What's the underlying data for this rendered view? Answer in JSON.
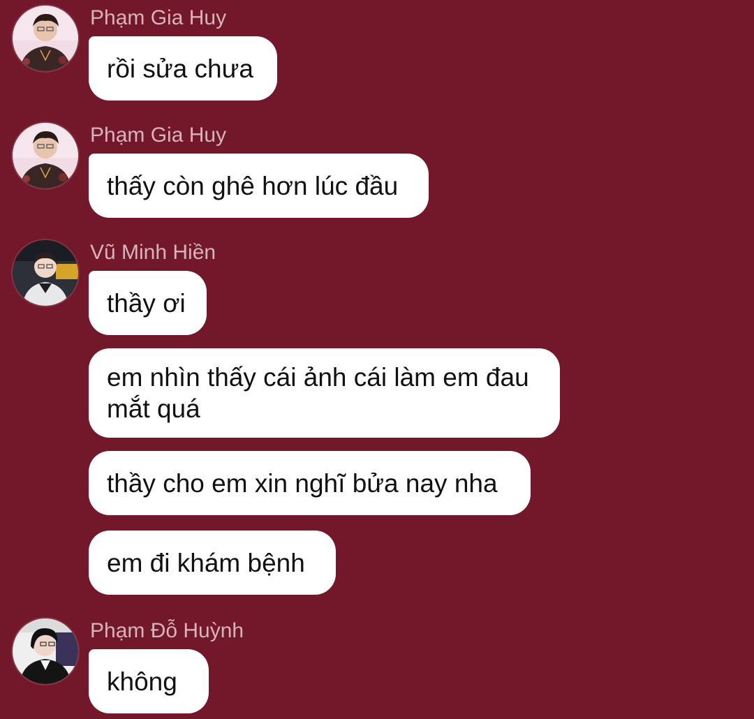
{
  "colors": {
    "background": "#73172a",
    "bubble": "#ffffff",
    "bubble_text": "#111111",
    "sender_name": "#d6b4bc"
  },
  "messages": [
    {
      "sender": "Phạm Gia Huy",
      "avatar": "avatar-pham-gia-huy",
      "text": "rồi sửa chưa"
    },
    {
      "sender": "Phạm Gia Huy",
      "avatar": "avatar-pham-gia-huy",
      "text": "thấy còn ghê hơn lúc đầu"
    },
    {
      "sender": "Vũ Minh Hiền",
      "avatar": "avatar-vu-minh-hien",
      "texts": [
        "thầy ơi",
        "em nhìn thấy cái ảnh cái làm em đau mắt quá",
        "thầy cho em xin nghĩ bửa nay nha",
        "em đi khám bệnh"
      ]
    },
    {
      "sender": "Phạm Đỗ Huỳnh",
      "avatar": "avatar-pham-do-huynh",
      "text": "không"
    }
  ]
}
